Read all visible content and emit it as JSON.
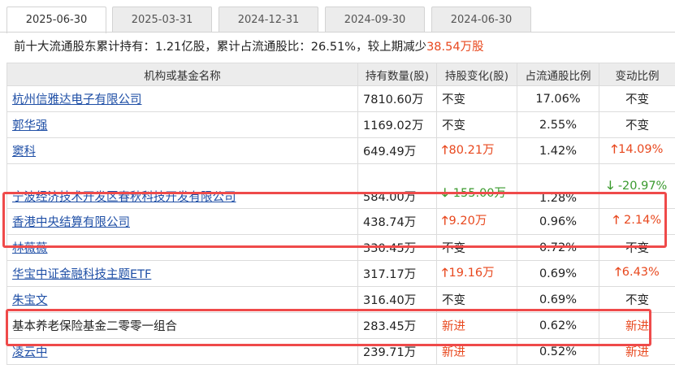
{
  "tabs": [
    "2025-06-30",
    "2025-03-31",
    "2024-12-31",
    "2024-09-30",
    "2024-06-30"
  ],
  "summary": {
    "prefix": "前十大流通股东累计持有：1.21亿股，累计占流通股比：26.51%，较上期减少",
    "change": "38.54万股"
  },
  "table": {
    "headers": [
      "机构或基金名称",
      "持有数量(股)",
      "持股变化(股)",
      "占流通股比例",
      "变动比例"
    ],
    "rows": [
      {
        "name": "杭州信雅达电子有限公司",
        "qty": "7810.60万",
        "change": "不变",
        "ratio": "17.06%",
        "pct": "不变"
      },
      {
        "name": "郭华强",
        "qty": "1169.02万",
        "change": "不变",
        "ratio": "2.55%",
        "pct": "不变"
      },
      {
        "name": "窦科",
        "qty": "649.49万",
        "change": "80.21万",
        "ratio": "1.42%",
        "pct": "14.09%"
      },
      {
        "name": "宁波经济技术开发区春秋科技开发有限公司",
        "qty": "584.00万",
        "change": "-155.00万",
        "ratio": "1.28%",
        "pct": "-20.97%"
      },
      {
        "name": "香港中央结算有限公司",
        "qty": "438.74万",
        "change": "9.20万",
        "ratio": "0.96%",
        "pct": "2.14%"
      },
      {
        "name": "林薇薇",
        "qty": "330.45万",
        "change": "不变",
        "ratio": "0.72%",
        "pct": "不变"
      },
      {
        "name": "华宝中证金融科技主题ETF",
        "qty": "317.17万",
        "change": "19.16万",
        "ratio": "0.69%",
        "pct": "6.43%"
      },
      {
        "name": "朱宝文",
        "qty": "316.40万",
        "change": "不变",
        "ratio": "0.69%",
        "pct": "不变"
      },
      {
        "name": "基本养老保险基金二零零一组合",
        "qty": "283.45万",
        "change": "新进",
        "ratio": "0.62%",
        "pct": "新进"
      },
      {
        "name": "凌云中",
        "qty": "239.71万",
        "change": "新进",
        "ratio": "0.52%",
        "pct": "新进"
      }
    ]
  },
  "icons": {
    "up": "arrow-up-icon",
    "down": "arrow-down-icon"
  },
  "colors": {
    "increase": "#e8481e",
    "decrease": "#3a9a2e",
    "link": "#1f4fa6",
    "highlight": "#ef4a4a"
  }
}
